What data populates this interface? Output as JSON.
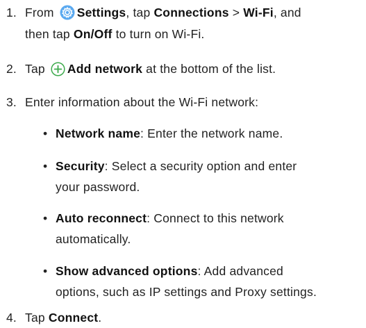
{
  "steps": [
    {
      "num": "1.",
      "l1_pre": "From",
      "l1_b1": "Settings",
      "l1_t2": ", tap",
      "l1_b2": "Connections",
      "l1_t3": ">",
      "l1_b3": "Wi-Fi",
      "l1_t4": ", and",
      "l2_pre": "then tap",
      "l2_b": "On/Off",
      "l2_post": "to turn on Wi-Fi."
    },
    {
      "num": "2.",
      "pre": "Tap",
      "b": "Add network",
      "post": "at the bottom of the list."
    },
    {
      "num": "3.",
      "text": "Enter information about the Wi-Fi network:"
    },
    {
      "num": "4.",
      "pre": "Tap",
      "b": "Connect",
      "post": "."
    }
  ],
  "bullets": [
    {
      "b": "Network name",
      "l1": ": Enter the network name."
    },
    {
      "b": "Security",
      "l1": ": Select a security option and enter",
      "l2": "your password."
    },
    {
      "b": "Auto reconnect",
      "l1": ": Connect to this network",
      "l2": "automatically."
    },
    {
      "b": "Show advanced options",
      "l1": ": Add advanced",
      "l2": "options, such as IP settings and Proxy settings."
    }
  ],
  "bullet_glyph": "•",
  "icons": {
    "settings": "settings-gear-icon",
    "add": "add-circle-icon"
  },
  "colors": {
    "settings_icon_bg": "#5aa9f0",
    "add_icon": "#3daa4c",
    "text": "#222222"
  }
}
